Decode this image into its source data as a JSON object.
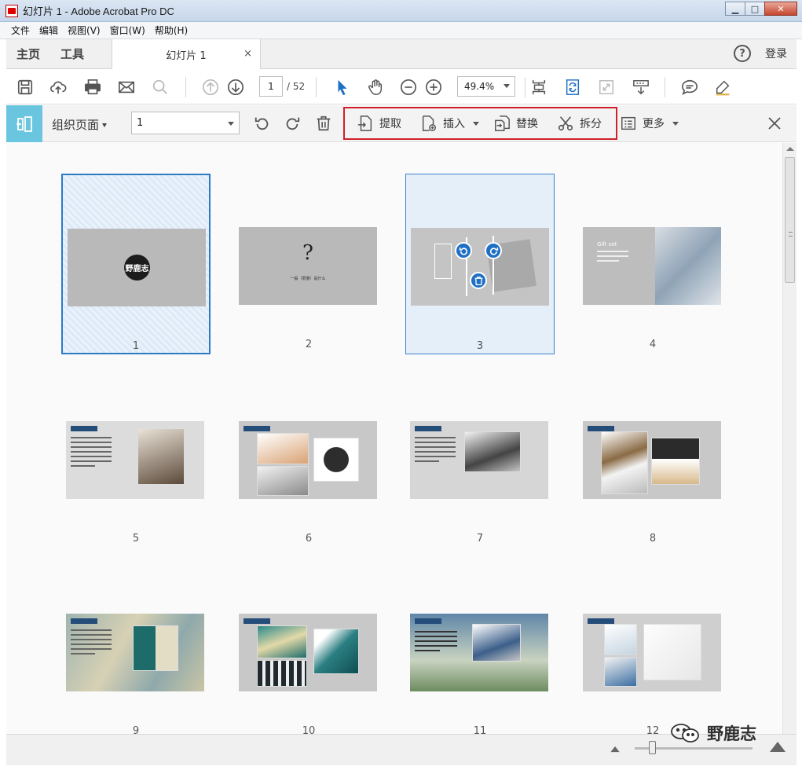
{
  "window": {
    "title": "幻灯片 1 - Adobe Acrobat Pro DC",
    "minimize": "▁",
    "maximize": "□",
    "close": "✕"
  },
  "menu": [
    "文件",
    "编辑",
    "视图(V)",
    "窗口(W)",
    "帮助(H)"
  ],
  "tabs": {
    "home": "主页",
    "tools": "工具",
    "document": "幻灯片 1",
    "close": "×",
    "help": "?",
    "login": "登录"
  },
  "toolbar": {
    "page_current": "1",
    "page_total": "/ 52",
    "zoom": "49.4%"
  },
  "organize": {
    "label": "组织页面",
    "page_selector": "1",
    "actions": {
      "extract": "提取",
      "insert": "插入",
      "replace": "替换",
      "split": "拆分",
      "more": "更多"
    }
  },
  "colors": {
    "accent": "#1f6fc4",
    "org_icon_bg": "#69c6de",
    "highlight": "#d0202a",
    "selection": "#2d7bc4"
  },
  "slides": {
    "logo_text": "野鹿志",
    "slide2_mark": "?",
    "slide2_caption": "一般（限量）是什么",
    "slide4_title": "Gift set"
  },
  "pages": [
    "1",
    "2",
    "3",
    "4",
    "5",
    "6",
    "7",
    "8",
    "9",
    "10",
    "11",
    "12"
  ],
  "watermark": "野鹿志",
  "icons": [
    "save-icon",
    "upload-icon",
    "print-icon",
    "mail-icon",
    "search-icon",
    "page-up-icon",
    "page-down-icon",
    "select-arrow-icon",
    "hand-icon",
    "zoom-out-icon",
    "zoom-in-icon",
    "fit-page-icon",
    "rotate-view-icon",
    "fullscreen-icon",
    "scroll-mode-icon",
    "comment-icon",
    "highlight-pen-icon",
    "rotate-left-icon",
    "rotate-right-icon",
    "delete-icon",
    "extract-icon",
    "insert-icon",
    "replace-icon",
    "split-icon",
    "more-icon",
    "close-icon"
  ]
}
